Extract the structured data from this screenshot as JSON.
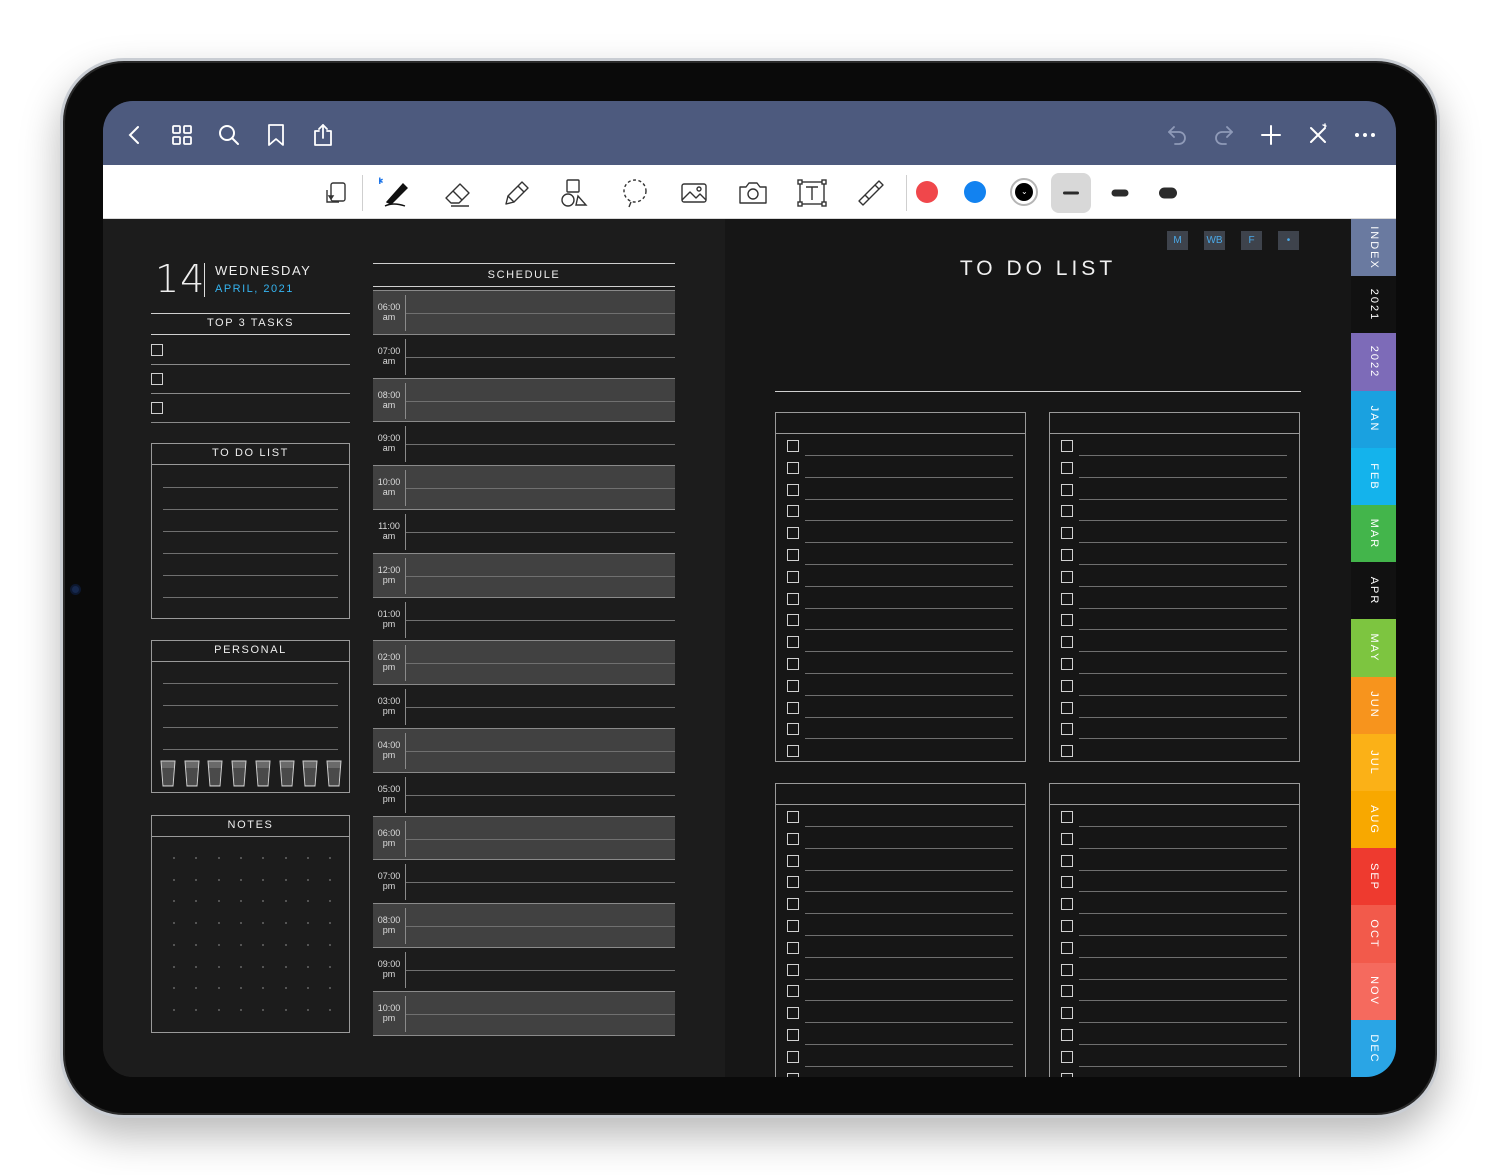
{
  "top_bar": {
    "left_icons": [
      "back-icon",
      "thumbnails-icon",
      "search-icon",
      "bookmark-icon",
      "share-icon"
    ],
    "right_icons": [
      "undo-icon",
      "redo-icon",
      "add-page-icon",
      "close-icon",
      "more-icon"
    ]
  },
  "toolbar": {
    "tools": [
      "page-scroll-icon",
      "pen-icon",
      "eraser-icon",
      "highlighter-icon",
      "shapes-icon",
      "lasso-icon",
      "image-icon",
      "camera-icon",
      "text-icon",
      "laser-pointer-icon"
    ],
    "colors": [
      "#f0474b",
      "#1282f0",
      "#000000"
    ],
    "selected_width": "thin"
  },
  "left_page": {
    "day_number": "14",
    "weekday": "WEDNESDAY",
    "month_year": "APRIL, 2021",
    "top3_title": "TOP 3 TASKS",
    "todo_title": "TO DO LIST",
    "personal_title": "PERSONAL",
    "notes_title": "NOTES",
    "water_glasses": 8,
    "schedule_title": "SCHEDULE",
    "schedule": [
      {
        "time": "06:00",
        "period": "am"
      },
      {
        "time": "07:00",
        "period": "am"
      },
      {
        "time": "08:00",
        "period": "am"
      },
      {
        "time": "09:00",
        "period": "am"
      },
      {
        "time": "10:00",
        "period": "am"
      },
      {
        "time": "11:00",
        "period": "am"
      },
      {
        "time": "12:00",
        "period": "pm"
      },
      {
        "time": "01:00",
        "period": "pm"
      },
      {
        "time": "02:00",
        "period": "pm"
      },
      {
        "time": "03:00",
        "period": "pm"
      },
      {
        "time": "04:00",
        "period": "pm"
      },
      {
        "time": "05:00",
        "period": "pm"
      },
      {
        "time": "06:00",
        "period": "pm"
      },
      {
        "time": "07:00",
        "period": "pm"
      },
      {
        "time": "08:00",
        "period": "pm"
      },
      {
        "time": "09:00",
        "period": "pm"
      },
      {
        "time": "10:00",
        "period": "pm"
      }
    ]
  },
  "right_page": {
    "title": "TO DO LIST",
    "quick_links": [
      "M",
      "WB",
      "F",
      "•"
    ],
    "list_boxes": 4,
    "items_per_box": 15
  },
  "side_tabs": [
    {
      "label": "INDEX",
      "color": "#6a7aa0"
    },
    {
      "label": "2021",
      "color": "#111111"
    },
    {
      "label": "2022",
      "color": "#7d6bb8"
    },
    {
      "label": "JAN",
      "color": "#1aa1e0"
    },
    {
      "label": "FEB",
      "color": "#14b3ec"
    },
    {
      "label": "MAR",
      "color": "#43b54b"
    },
    {
      "label": "APR",
      "color": "#111111"
    },
    {
      "label": "MAY",
      "color": "#7dc540"
    },
    {
      "label": "JUN",
      "color": "#f7941d"
    },
    {
      "label": "JUL",
      "color": "#fbb117"
    },
    {
      "label": "AUG",
      "color": "#f8a800"
    },
    {
      "label": "SEP",
      "color": "#ee3a2f"
    },
    {
      "label": "OCT",
      "color": "#f25a4b"
    },
    {
      "label": "NOV",
      "color": "#f56a5e"
    },
    {
      "label": "DEC",
      "color": "#2aa5e5"
    }
  ]
}
